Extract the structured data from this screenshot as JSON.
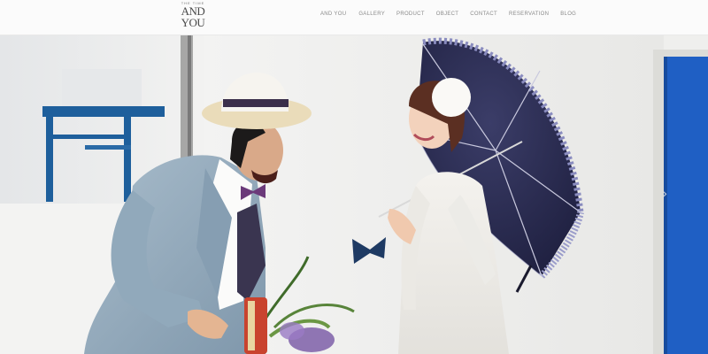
{
  "header": {
    "logo": {
      "tagline": "THE TIME",
      "line1": "AND",
      "line2": "YOU"
    },
    "nav": [
      {
        "label": "AND YOU"
      },
      {
        "label": "GALLERY"
      },
      {
        "label": "PRODUCT"
      },
      {
        "label": "OBJECT"
      },
      {
        "label": "CONTACT"
      },
      {
        "label": "RESERVATION"
      },
      {
        "label": "BLOG"
      }
    ]
  },
  "hero": {
    "slider_next_glyph": "›"
  },
  "colors": {
    "header_bg": "#fbfbfb",
    "nav_text": "#8a8a8a",
    "door_blue": "#1f5fc4",
    "railing_blue": "#1e5f9c",
    "umbrella_navy": "#24254a",
    "suit_gray": "#8ea6b8",
    "bow_tie_purple": "#6b3a7a"
  }
}
